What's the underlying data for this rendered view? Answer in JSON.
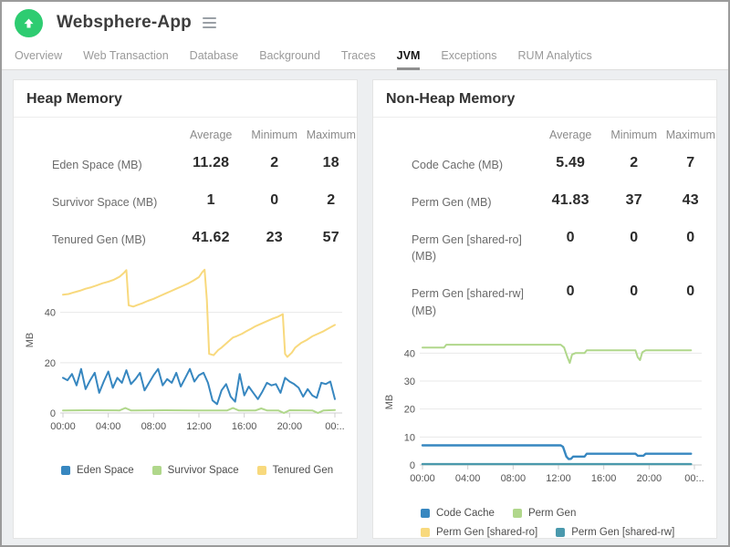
{
  "header": {
    "app_title": "Websphere-App",
    "status_icon": "up-arrow-circle-icon",
    "status_color": "#2ecc71"
  },
  "tabs": {
    "items": [
      {
        "label": "Overview",
        "active": false
      },
      {
        "label": "Web Transaction",
        "active": false
      },
      {
        "label": "Database",
        "active": false
      },
      {
        "label": "Background",
        "active": false
      },
      {
        "label": "Traces",
        "active": false
      },
      {
        "label": "JVM",
        "active": true
      },
      {
        "label": "Exceptions",
        "active": false
      },
      {
        "label": "RUM Analytics",
        "active": false
      }
    ]
  },
  "panels": [
    {
      "title": "Heap Memory",
      "table": {
        "headers": [
          "Average",
          "Minimum",
          "Maximum"
        ],
        "rows": [
          {
            "label": "Eden Space (MB)",
            "average": "11.28",
            "minimum": "2",
            "maximum": "18"
          },
          {
            "label": "Survivor Space (MB)",
            "average": "1",
            "minimum": "0",
            "maximum": "2"
          },
          {
            "label": "Tenured Gen (MB)",
            "average": "41.62",
            "minimum": "23",
            "maximum": "57"
          }
        ]
      }
    },
    {
      "title": "Non-Heap Memory",
      "table": {
        "headers": [
          "Average",
          "Minimum",
          "Maximum"
        ],
        "rows": [
          {
            "label": "Code Cache (MB)",
            "average": "5.49",
            "minimum": "2",
            "maximum": "7"
          },
          {
            "label": "Perm Gen (MB)",
            "average": "41.83",
            "minimum": "37",
            "maximum": "43"
          },
          {
            "label": "Perm Gen [shared-ro] (MB)",
            "average": "0",
            "minimum": "0",
            "maximum": "0"
          },
          {
            "label": "Perm Gen [shared-rw] (MB)",
            "average": "0",
            "minimum": "0",
            "maximum": "0"
          }
        ]
      }
    }
  ],
  "chart_data": [
    {
      "type": "line",
      "title": "Heap Memory",
      "xlabel": "",
      "ylabel": "MB",
      "ylim": [
        0,
        58
      ],
      "yticks": [
        0,
        20,
        40
      ],
      "grid": true,
      "legend_position": "bottom",
      "xticks": {
        "hours": [
          0,
          4,
          8,
          12,
          16,
          20,
          24
        ],
        "labels": [
          "00:00",
          "04:00",
          "08:00",
          "12:00",
          "16:00",
          "20:00",
          "00:.."
        ]
      },
      "series": [
        {
          "name": "Eden Space",
          "color": "#3787c0",
          "width": 2,
          "x0": 0,
          "dx": 0.4,
          "values": [
            14,
            13,
            15.5,
            11,
            17.5,
            9.5,
            13,
            16,
            8,
            12.5,
            16.5,
            10,
            14,
            12,
            17,
            11.5,
            13.5,
            16,
            9,
            12,
            15,
            17.5,
            11,
            13.5,
            12,
            16,
            10.5,
            14,
            17.5,
            12.5,
            15,
            16,
            12,
            5,
            3.5,
            9,
            11.5,
            6.5,
            4.5,
            15.5,
            7,
            10.5,
            8,
            5.5,
            8.5,
            12,
            11,
            11.5,
            8,
            14,
            12.5,
            11.5,
            10,
            6.5,
            9.5,
            7,
            6,
            12,
            11.5,
            12.5,
            5.5
          ]
        },
        {
          "name": "Survivor Space",
          "color": "#b0d78b",
          "width": 2,
          "points": [
            [
              0,
              1
            ],
            [
              2,
              1.1
            ],
            [
              5,
              1
            ],
            [
              5.5,
              2
            ],
            [
              6,
              1
            ],
            [
              9,
              1.1
            ],
            [
              12,
              1
            ],
            [
              14.5,
              1
            ],
            [
              15,
              2
            ],
            [
              15.5,
              1
            ],
            [
              17,
              1
            ],
            [
              17.5,
              1.8
            ],
            [
              18,
              1
            ],
            [
              19,
              1
            ],
            [
              19.5,
              0
            ],
            [
              20,
              1.1
            ],
            [
              22,
              1
            ],
            [
              22.5,
              0
            ],
            [
              23,
              1
            ],
            [
              24,
              1.2
            ]
          ]
        },
        {
          "name": "Tenured Gen",
          "color": "#f8d97d",
          "width": 2,
          "points": [
            [
              0,
              47
            ],
            [
              0.5,
              47.3
            ],
            [
              1,
              48
            ],
            [
              1.5,
              48.6
            ],
            [
              2,
              49.4
            ],
            [
              2.5,
              50
            ],
            [
              3,
              50.8
            ],
            [
              3.5,
              51.6
            ],
            [
              4,
              52.2
            ],
            [
              4.5,
              53
            ],
            [
              5,
              54.2
            ],
            [
              5.4,
              55.8
            ],
            [
              5.6,
              56.8
            ],
            [
              5.8,
              42.8
            ],
            [
              6.2,
              42.3
            ],
            [
              6.6,
              43
            ],
            [
              7,
              43.6
            ],
            [
              7.5,
              44.6
            ],
            [
              8,
              45.4
            ],
            [
              8.5,
              46.4
            ],
            [
              9,
              47.4
            ],
            [
              9.5,
              48.4
            ],
            [
              10,
              49.4
            ],
            [
              10.5,
              50.4
            ],
            [
              11,
              51.4
            ],
            [
              11.5,
              52.6
            ],
            [
              12,
              54
            ],
            [
              12.3,
              56
            ],
            [
              12.5,
              57
            ],
            [
              12.7,
              45
            ],
            [
              12.9,
              23.5
            ],
            [
              13.3,
              23
            ],
            [
              13.7,
              25
            ],
            [
              14,
              26
            ],
            [
              14.5,
              28
            ],
            [
              15,
              30
            ],
            [
              15.3,
              30.5
            ],
            [
              15.8,
              31.5
            ],
            [
              16.2,
              32.5
            ],
            [
              16.6,
              33.5
            ],
            [
              17,
              34.5
            ],
            [
              17.5,
              35.5
            ],
            [
              18,
              36.5
            ],
            [
              18.5,
              37.5
            ],
            [
              19,
              38.3
            ],
            [
              19.4,
              39.3
            ],
            [
              19.6,
              23.5
            ],
            [
              19.8,
              22.3
            ],
            [
              20.2,
              24
            ],
            [
              20.5,
              26
            ],
            [
              21,
              27.8
            ],
            [
              21.5,
              29
            ],
            [
              22,
              30.5
            ],
            [
              22.5,
              31.5
            ],
            [
              23,
              32.5
            ],
            [
              23.5,
              33.8
            ],
            [
              24,
              35
            ]
          ]
        }
      ]
    },
    {
      "type": "line",
      "title": "Non-Heap Memory",
      "xlabel": "",
      "ylabel": "MB",
      "ylim": [
        0,
        45
      ],
      "yticks": [
        0,
        10,
        20,
        30,
        40
      ],
      "grid": true,
      "legend_position": "bottom",
      "xticks": {
        "hours": [
          0,
          4,
          8,
          12,
          16,
          20,
          24
        ],
        "labels": [
          "00:00",
          "04:00",
          "08:00",
          "12:00",
          "16:00",
          "20:00",
          "00:.."
        ]
      },
      "series": [
        {
          "name": "Code Cache",
          "color": "#3787c0",
          "width": 2.4,
          "points": [
            [
              0,
              7
            ],
            [
              12.2,
              7
            ],
            [
              12.4,
              6.5
            ],
            [
              12.7,
              3
            ],
            [
              12.9,
              2.1
            ],
            [
              13.1,
              2.2
            ],
            [
              13.3,
              3
            ],
            [
              14.3,
              3
            ],
            [
              14.5,
              4
            ],
            [
              18.8,
              4
            ],
            [
              19,
              3.3
            ],
            [
              19.5,
              3.3
            ],
            [
              19.7,
              4
            ],
            [
              23.7,
              4
            ]
          ]
        },
        {
          "name": "Perm Gen",
          "color": "#b0d78b",
          "width": 2,
          "points": [
            [
              0,
              42
            ],
            [
              1.9,
              42
            ],
            [
              2.1,
              43
            ],
            [
              12.2,
              43
            ],
            [
              12.5,
              42
            ],
            [
              12.8,
              38.5
            ],
            [
              13,
              36.5
            ],
            [
              13.2,
              39.5
            ],
            [
              13.5,
              40
            ],
            [
              14.3,
              40
            ],
            [
              14.5,
              41
            ],
            [
              18.8,
              41
            ],
            [
              19,
              38.5
            ],
            [
              19.2,
              37.5
            ],
            [
              19.4,
              40.3
            ],
            [
              19.7,
              41
            ],
            [
              23.7,
              41
            ]
          ]
        },
        {
          "name": "Perm Gen [shared-ro]",
          "color": "#f8d97d",
          "width": 2,
          "points": [
            [
              0,
              0.3
            ],
            [
              23.7,
              0.3
            ]
          ]
        },
        {
          "name": "Perm Gen [shared-rw]",
          "color": "#4a99ad",
          "width": 2.4,
          "points": [
            [
              0,
              0.3
            ],
            [
              23.7,
              0.3
            ]
          ]
        }
      ]
    }
  ]
}
